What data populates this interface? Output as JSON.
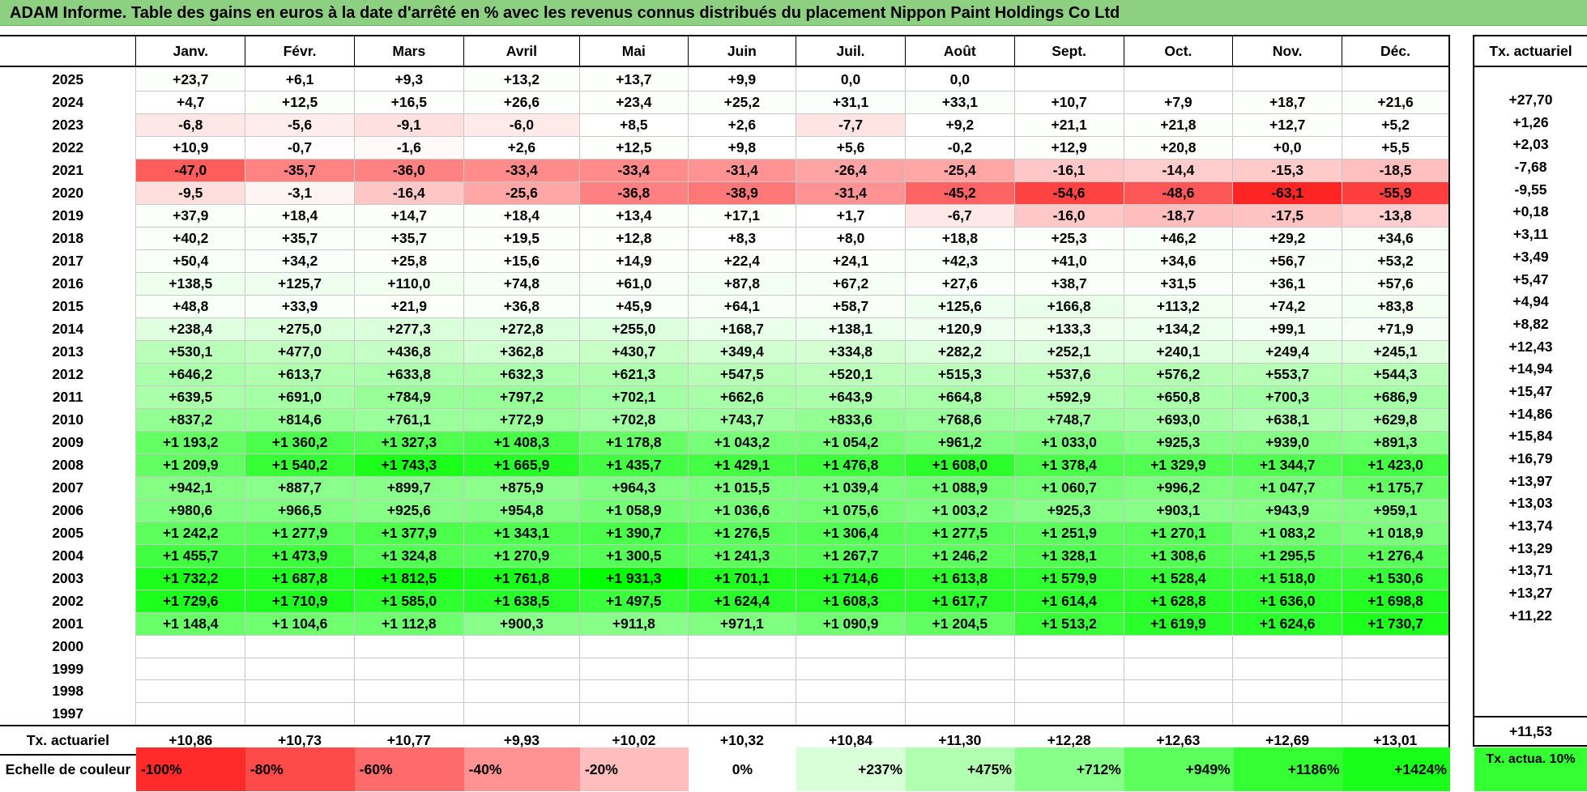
{
  "title": "ADAM Informe. Table des gains en euros à la date d'arrêté en % avec les revenus connus distribués du placement Nippon Paint Holdings Co Ltd",
  "months": [
    "Janv.",
    "Févr.",
    "Mars",
    "Avril",
    "Mai",
    "Juin",
    "Juil.",
    "Août",
    "Sept.",
    "Oct.",
    "Nov.",
    "Déc."
  ],
  "side_header": "Tx. actuariel",
  "rows": [
    {
      "year": "2025",
      "values": [
        "+23,7",
        "+6,1",
        "+9,3",
        "+13,2",
        "+13,7",
        "+9,9",
        "0,0",
        "0,0",
        "",
        "",
        "",
        ""
      ],
      "rate": ""
    },
    {
      "year": "2024",
      "values": [
        "+4,7",
        "+12,5",
        "+16,5",
        "+26,6",
        "+23,4",
        "+25,2",
        "+31,1",
        "+33,1",
        "+10,7",
        "+7,9",
        "+18,7",
        "+21,6"
      ],
      "rate": "+27,70"
    },
    {
      "year": "2023",
      "values": [
        "-6,8",
        "-5,6",
        "-9,1",
        "-6,0",
        "+8,5",
        "+2,6",
        "-7,7",
        "+9,2",
        "+21,1",
        "+21,8",
        "+12,7",
        "+5,2"
      ],
      "rate": "+1,26"
    },
    {
      "year": "2022",
      "values": [
        "+10,9",
        "-0,7",
        "-1,6",
        "+2,6",
        "+12,5",
        "+9,8",
        "+5,6",
        "-0,2",
        "+12,9",
        "+20,8",
        "+0,0",
        "+5,5"
      ],
      "rate": "+2,03"
    },
    {
      "year": "2021",
      "values": [
        "-47,0",
        "-35,7",
        "-36,0",
        "-33,4",
        "-33,4",
        "-31,4",
        "-26,4",
        "-25,4",
        "-16,1",
        "-14,4",
        "-15,3",
        "-18,5"
      ],
      "rate": "-7,68"
    },
    {
      "year": "2020",
      "values": [
        "-9,5",
        "-3,1",
        "-16,4",
        "-25,6",
        "-36,8",
        "-38,9",
        "-31,4",
        "-45,2",
        "-54,6",
        "-48,6",
        "-63,1",
        "-55,9"
      ],
      "rate": "-9,55"
    },
    {
      "year": "2019",
      "values": [
        "+37,9",
        "+18,4",
        "+14,7",
        "+18,4",
        "+13,4",
        "+17,1",
        "+1,7",
        "-6,7",
        "-16,0",
        "-18,7",
        "-17,5",
        "-13,8"
      ],
      "rate": "+0,18"
    },
    {
      "year": "2018",
      "values": [
        "+40,2",
        "+35,7",
        "+35,7",
        "+19,5",
        "+12,8",
        "+8,3",
        "+8,0",
        "+18,8",
        "+25,3",
        "+46,2",
        "+29,2",
        "+34,6"
      ],
      "rate": "+3,11"
    },
    {
      "year": "2017",
      "values": [
        "+50,4",
        "+34,2",
        "+25,8",
        "+15,6",
        "+14,9",
        "+22,4",
        "+24,1",
        "+42,3",
        "+41,0",
        "+34,6",
        "+56,7",
        "+53,2"
      ],
      "rate": "+3,49"
    },
    {
      "year": "2016",
      "values": [
        "+138,5",
        "+125,7",
        "+110,0",
        "+74,8",
        "+61,0",
        "+87,8",
        "+67,2",
        "+27,6",
        "+38,7",
        "+31,5",
        "+36,1",
        "+57,6"
      ],
      "rate": "+5,47"
    },
    {
      "year": "2015",
      "values": [
        "+48,8",
        "+33,9",
        "+21,9",
        "+36,8",
        "+45,9",
        "+64,1",
        "+58,7",
        "+125,6",
        "+166,8",
        "+113,2",
        "+74,2",
        "+83,8"
      ],
      "rate": "+4,94"
    },
    {
      "year": "2014",
      "values": [
        "+238,4",
        "+275,0",
        "+277,3",
        "+272,8",
        "+255,0",
        "+168,7",
        "+138,1",
        "+120,9",
        "+133,3",
        "+134,2",
        "+99,1",
        "+71,9"
      ],
      "rate": "+8,82"
    },
    {
      "year": "2013",
      "values": [
        "+530,1",
        "+477,0",
        "+436,8",
        "+362,8",
        "+430,7",
        "+349,4",
        "+334,8",
        "+282,2",
        "+252,1",
        "+240,1",
        "+249,4",
        "+245,1"
      ],
      "rate": "+12,43"
    },
    {
      "year": "2012",
      "values": [
        "+646,2",
        "+613,7",
        "+633,8",
        "+632,3",
        "+621,3",
        "+547,5",
        "+520,1",
        "+515,3",
        "+537,6",
        "+576,2",
        "+553,7",
        "+544,3"
      ],
      "rate": "+14,94"
    },
    {
      "year": "2011",
      "values": [
        "+639,5",
        "+691,0",
        "+784,9",
        "+797,2",
        "+702,1",
        "+662,6",
        "+643,9",
        "+664,8",
        "+592,9",
        "+650,8",
        "+700,3",
        "+686,9"
      ],
      "rate": "+15,47"
    },
    {
      "year": "2010",
      "values": [
        "+837,2",
        "+814,6",
        "+761,1",
        "+772,9",
        "+702,8",
        "+743,7",
        "+833,6",
        "+768,6",
        "+748,7",
        "+693,0",
        "+638,1",
        "+629,8"
      ],
      "rate": "+14,86"
    },
    {
      "year": "2009",
      "values": [
        "+1 193,2",
        "+1 360,2",
        "+1 327,3",
        "+1 408,3",
        "+1 178,8",
        "+1 043,2",
        "+1 054,2",
        "+961,2",
        "+1 033,0",
        "+925,3",
        "+939,0",
        "+891,3"
      ],
      "rate": "+15,84"
    },
    {
      "year": "2008",
      "values": [
        "+1 209,9",
        "+1 540,2",
        "+1 743,3",
        "+1 665,9",
        "+1 435,7",
        "+1 429,1",
        "+1 476,8",
        "+1 608,0",
        "+1 378,4",
        "+1 329,9",
        "+1 344,7",
        "+1 423,0"
      ],
      "rate": "+16,79"
    },
    {
      "year": "2007",
      "values": [
        "+942,1",
        "+887,7",
        "+899,7",
        "+875,9",
        "+964,3",
        "+1 015,5",
        "+1 039,4",
        "+1 088,9",
        "+1 060,7",
        "+996,2",
        "+1 047,7",
        "+1 175,7"
      ],
      "rate": "+13,97"
    },
    {
      "year": "2006",
      "values": [
        "+980,6",
        "+966,5",
        "+925,6",
        "+954,8",
        "+1 058,9",
        "+1 036,6",
        "+1 075,6",
        "+1 003,2",
        "+925,3",
        "+903,1",
        "+943,9",
        "+959,1"
      ],
      "rate": "+13,03"
    },
    {
      "year": "2005",
      "values": [
        "+1 242,2",
        "+1 277,9",
        "+1 377,9",
        "+1 343,1",
        "+1 390,7",
        "+1 276,5",
        "+1 306,4",
        "+1 277,5",
        "+1 251,9",
        "+1 270,1",
        "+1 083,2",
        "+1 018,9"
      ],
      "rate": "+13,74"
    },
    {
      "year": "2004",
      "values": [
        "+1 455,7",
        "+1 473,9",
        "+1 324,8",
        "+1 270,9",
        "+1 300,5",
        "+1 241,3",
        "+1 267,7",
        "+1 246,2",
        "+1 328,1",
        "+1 308,6",
        "+1 295,5",
        "+1 276,4"
      ],
      "rate": "+13,29"
    },
    {
      "year": "2003",
      "values": [
        "+1 732,2",
        "+1 687,8",
        "+1 812,5",
        "+1 761,8",
        "+1 931,3",
        "+1 701,1",
        "+1 714,6",
        "+1 613,8",
        "+1 579,9",
        "+1 528,4",
        "+1 518,0",
        "+1 530,6"
      ],
      "rate": "+13,71"
    },
    {
      "year": "2002",
      "values": [
        "+1 729,6",
        "+1 710,9",
        "+1 585,0",
        "+1 638,5",
        "+1 497,5",
        "+1 624,4",
        "+1 608,3",
        "+1 617,7",
        "+1 614,4",
        "+1 628,8",
        "+1 636,0",
        "+1 698,8"
      ],
      "rate": "+13,27"
    },
    {
      "year": "2001",
      "values": [
        "+1 148,4",
        "+1 104,6",
        "+1 112,8",
        "+900,3",
        "+911,8",
        "+971,1",
        "+1 090,9",
        "+1 204,5",
        "+1 513,2",
        "+1 619,9",
        "+1 624,6",
        "+1 730,7"
      ],
      "rate": "+11,22"
    },
    {
      "year": "2000",
      "values": [
        "",
        "",
        "",
        "",
        "",
        "",
        "",
        "",
        "",
        "",
        "",
        ""
      ],
      "rate": ""
    },
    {
      "year": "1999",
      "values": [
        "",
        "",
        "",
        "",
        "",
        "",
        "",
        "",
        "",
        "",
        "",
        ""
      ],
      "rate": ""
    },
    {
      "year": "1998",
      "values": [
        "",
        "",
        "",
        "",
        "",
        "",
        "",
        "",
        "",
        "",
        "",
        ""
      ],
      "rate": ""
    },
    {
      "year": "1997",
      "values": [
        "",
        "",
        "",
        "",
        "",
        "",
        "",
        "",
        "",
        "",
        "",
        ""
      ],
      "rate": ""
    }
  ],
  "average_row": {
    "label": "Tx. actuariel",
    "values": [
      "+10,86",
      "+10,73",
      "+10,77",
      "+9,93",
      "+10,02",
      "+10,32",
      "+10,84",
      "+11,30",
      "+12,28",
      "+12,63",
      "+12,69",
      "+13,01"
    ],
    "rate": "+11,53"
  },
  "scale": {
    "label": "Echelle de couleur",
    "steps": [
      {
        "label": "-100%",
        "color": "#ff2a2a",
        "align": "left"
      },
      {
        "label": "-80%",
        "color": "#ff4a4a",
        "align": "left"
      },
      {
        "label": "-60%",
        "color": "#ff6b6b",
        "align": "left"
      },
      {
        "label": "-40%",
        "color": "#ff9292",
        "align": "left"
      },
      {
        "label": "-20%",
        "color": "#ffbdbd",
        "align": "left"
      },
      {
        "label": "0%",
        "color": "#ffffff",
        "align": "center"
      },
      {
        "label": "+237%",
        "color": "#d8ffd8",
        "align": "right"
      },
      {
        "label": "+475%",
        "color": "#b0ffb0",
        "align": "right"
      },
      {
        "label": "+712%",
        "color": "#88ff88",
        "align": "right"
      },
      {
        "label": "+949%",
        "color": "#5cff5c",
        "align": "right"
      },
      {
        "label": "+1186%",
        "color": "#33ff33",
        "align": "right"
      },
      {
        "label": "+1424%",
        "color": "#1aff1a",
        "align": "right"
      }
    ],
    "extra_label": "Tx. actua. 10%",
    "extra_color": "#33ff33"
  }
}
